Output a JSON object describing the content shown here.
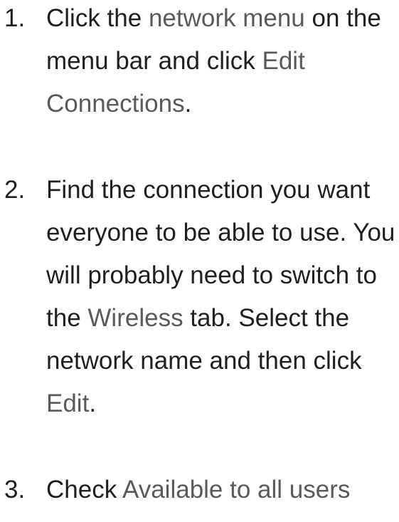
{
  "steps": [
    {
      "number": "1.",
      "parts": [
        {
          "text": "Click the ",
          "gui": false
        },
        {
          "text": "network menu",
          "gui": true
        },
        {
          "text": " on the menu bar and click ",
          "gui": false
        },
        {
          "text": "Edit Connections",
          "gui": true
        },
        {
          "text": ".",
          "gui": false
        }
      ]
    },
    {
      "number": "2.",
      "parts": [
        {
          "text": "Find the connection you want everyone to be able to use. You will probably need to switch to the ",
          "gui": false
        },
        {
          "text": "Wireless",
          "gui": true
        },
        {
          "text": " tab. Select the network name and then click ",
          "gui": false
        },
        {
          "text": "Edit",
          "gui": true
        },
        {
          "text": ".",
          "gui": false
        }
      ]
    },
    {
      "number": "3.",
      "parts": [
        {
          "text": "Check ",
          "gui": false
        },
        {
          "text": "Available to all users",
          "gui": true
        }
      ]
    }
  ],
  "colors": {
    "text": "#1f1f1f",
    "gui_label": "#5a5a5a",
    "background": "#ffffff"
  }
}
